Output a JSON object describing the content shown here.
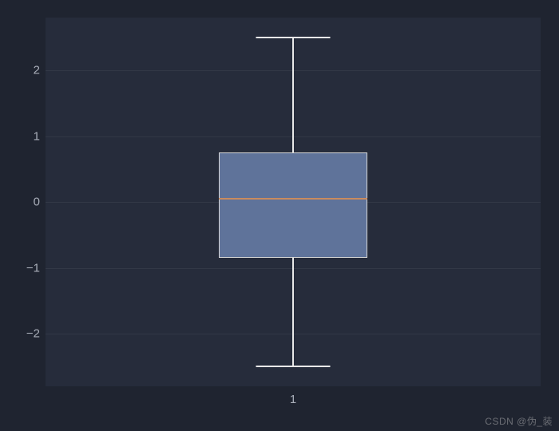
{
  "chart_data": {
    "type": "boxplot",
    "categories": [
      "1"
    ],
    "series": [
      {
        "name": "1",
        "min": -2.5,
        "q1": -0.85,
        "median": 0.05,
        "q3": 0.75,
        "max": 2.5
      }
    ],
    "title": "",
    "xlabel": "",
    "ylabel": "",
    "ylim": [
      -2.8,
      2.8
    ],
    "y_ticks": [
      -2,
      -1,
      0,
      1,
      2
    ],
    "x_ticks": [
      "1"
    ],
    "grid": true
  },
  "colors": {
    "background": "#1f2430",
    "plot_bg": "#262c3b",
    "box_fill": "#5f739a",
    "box_edge": "#d8d8d8",
    "whisker": "#e8e8e8",
    "median": "#c98b5e",
    "tick_text": "#a8adb8"
  },
  "watermark": "CSDN @伪_装"
}
